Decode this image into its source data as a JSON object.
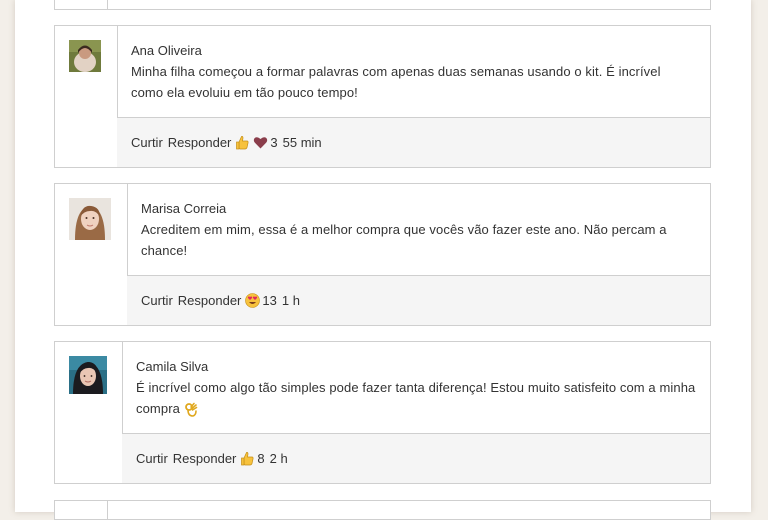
{
  "comments": [
    {
      "author": "Ana Oliveira",
      "text": "Minha filha começou a formar palavras com apenas duas semanas usando o kit. É incrível como ela evoluiu em tão pouco tempo!",
      "like_label": "Curtir",
      "reply_label": "Responder",
      "reactions": [
        "thumbs-up-icon",
        "heart-icon"
      ],
      "reaction_count": "3",
      "time": "55 min"
    },
    {
      "author": "Marisa Correia",
      "text": "Acreditem em mim, essa é a melhor compra que vocês vão fazer este ano. Não percam a chance!",
      "like_label": "Curtir",
      "reply_label": "Responder",
      "reactions": [
        "heart-eyes-icon"
      ],
      "reaction_count": "13",
      "time": "1 h"
    },
    {
      "author": "Camila Silva",
      "text": "É incrível como algo tão simples pode fazer tanta diferença! Estou muito satisfeito com a minha compra",
      "like_label": "Curtir",
      "reply_label": "Responder",
      "reactions": [
        "thumbs-up-icon"
      ],
      "reaction_count": "8",
      "time": "2 h"
    }
  ],
  "colors": {
    "border": "#cfcfcf",
    "footer_bg": "#f5f5f5",
    "text": "#333333"
  }
}
